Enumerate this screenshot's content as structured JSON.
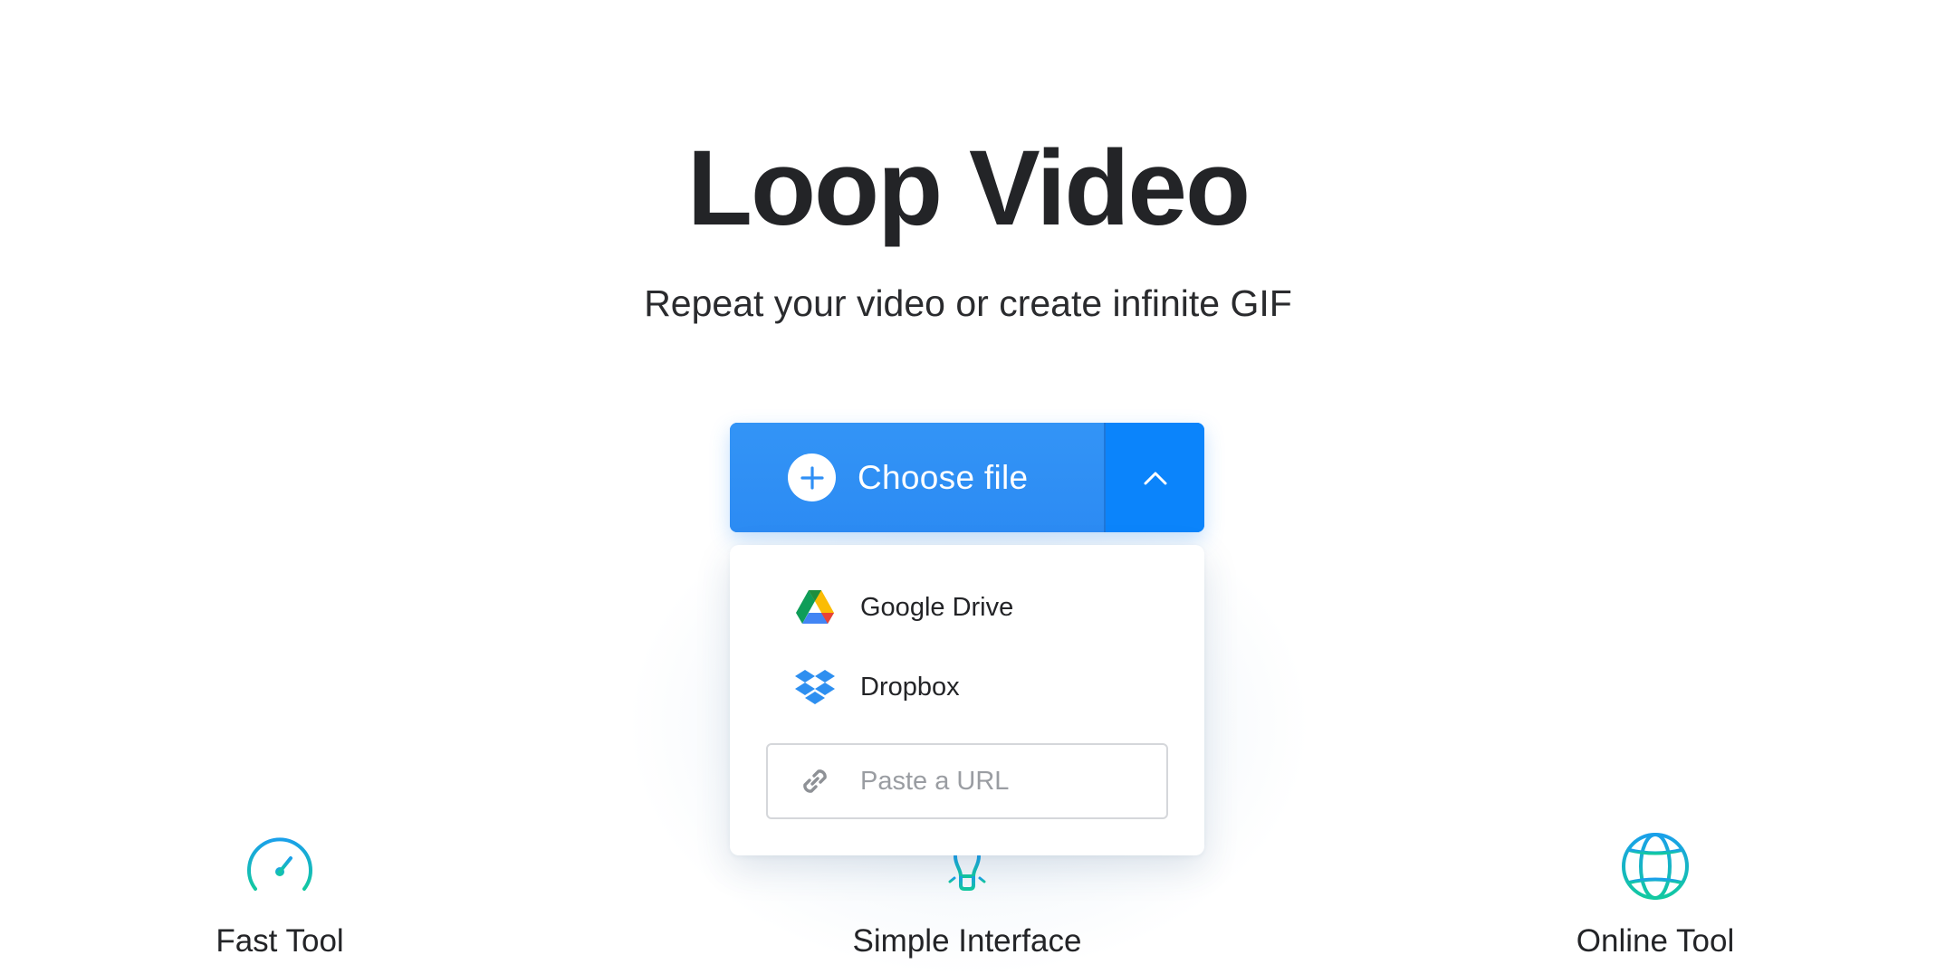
{
  "hero": {
    "title": "Loop Video",
    "subtitle": "Repeat your video or create infinite GIF"
  },
  "upload": {
    "choose_label": "Choose file",
    "plus_icon": "plus-icon",
    "toggle_icon": "chevron-up-icon",
    "colors": {
      "primary": "#2f8ff5",
      "toggle": "#0b84fb"
    }
  },
  "dropdown": {
    "items": [
      {
        "label": "Google Drive",
        "icon": "google-drive-icon"
      },
      {
        "label": "Dropbox",
        "icon": "dropbox-icon"
      }
    ],
    "url_placeholder": "Paste a URL",
    "url_icon": "link-icon"
  },
  "features": [
    {
      "label": "Fast Tool",
      "icon": "speedometer-icon"
    },
    {
      "label": "Simple Interface",
      "icon": "lightbulb-icon"
    },
    {
      "label": "Online Tool",
      "icon": "globe-icon"
    }
  ],
  "accent_gradient": [
    "#1aa7e8",
    "#14c6a2"
  ]
}
